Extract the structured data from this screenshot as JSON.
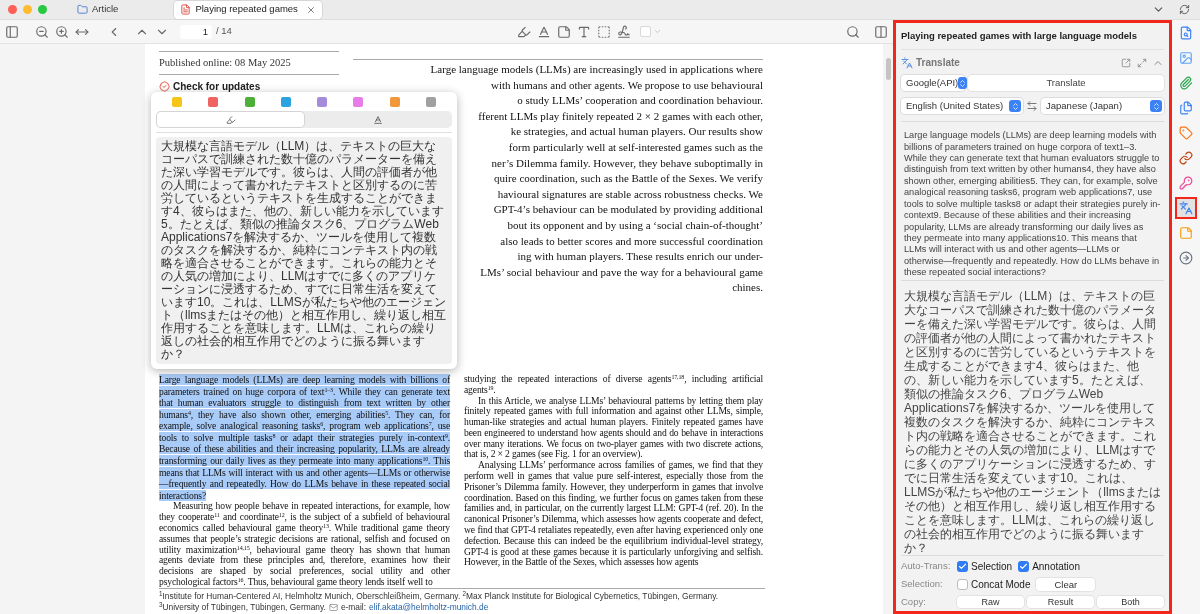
{
  "tabs": [
    {
      "label": "Article",
      "kind": "folder",
      "selected": false
    },
    {
      "label": "Playing repeated games",
      "kind": "pdf",
      "selected": true
    }
  ],
  "toolbar": {
    "page": "1",
    "page_count": "/ 14"
  },
  "document": {
    "published": "Published online: 08 May 2025",
    "check_updates": "Check for updates",
    "abstract_lines": [
      "Large language models (LLMs) are increasingly used in applications where",
      "with humans and other agents. We propose to use behavioural",
      "o study LLMs’ cooperation and coordination behaviour.",
      "fferent LLMs play finitely repeated 2 × 2 games with each other,",
      "ke strategies, and actual human players. Our results show",
      "form particularly well at self-interested games such as the",
      "ner’s Dilemma family. However, they behave suboptimally in",
      "quire coordination, such as the Battle of the Sexes. We verify",
      "havioural signatures are stable across robustness checks. We",
      "GPT-4’s behaviour can be modulated by providing additional",
      "bout its opponent and by using a ‘social chain-of-thought’",
      "also leads to better scores and more successful coordination",
      "ing with human players. These results enrich our under-",
      "LMs’ social behaviour and pave the way for a behavioural game",
      "chines."
    ],
    "left_column": [
      {
        "kind": "highlighted",
        "text": "Large language models (LLMs) are deep learning models with billions of parameters trained on huge corpora of text$^{1–3}$. While they can generate text that human evaluators struggle to distinguish from text written by other humans$^{4}$, they have also shown other, emerging abilities$^{5}$. They can, for example, solve analogical reasoning tasks$^{6}$, program web applications$^{7}$, use tools to solve multiple tasks$^{8}$ or adapt their strategies purely in-context$^{9}$. Because of these abilities and their increasing popularity, LLMs are already transforming our daily lives as they permeate into many applications$^{10}$. This means that LLMs will interact with us and other agents—LLMs or otherwise—frequently and repeatedly. How do LLMs behave in these repeated social interactions?"
      },
      {
        "kind": "plain",
        "text": "Measuring how people behave in repeated interactions, for example, how they cooperate$^{11}$ and coordinate$^{12}$, is the subject of a subfield of behavioural economics called behavioural game theory$^{13}$. While traditional game theory assumes that people’s strategic decisions are rational, selfish and focused on utility maximization$^{14,15}$, behavioural game theory has shown that human agents deviate from these principles and, therefore, examines how their decisions are shaped by social preferences, social utility and other psychological factors$^{16}$. Thus, behavioural game theory lends itself well to"
      }
    ],
    "right_column": [
      {
        "kind": "continued",
        "text": "studying the repeated interactions of diverse agents$^{17,18}$, including artificial agents$^{19}$."
      },
      {
        "kind": "plain",
        "text": "In this Article, we analyse LLMs’ behavioural patterns by letting them play finitely repeated games with full information and against other LLMs, simple, human-like strategies and actual human players. Finitely repeated games have been engineered to understand how agents should and do behave in interactions over many iterations. We focus on two-player games with two discrete actions, that is, 2 × 2 games (see Fig. 1 for an overview)."
      },
      {
        "kind": "plain",
        "text": "Analysing LLMs’ performance across families of games, we find that they perform well in games that value pure self-interest, especially those from the Prisoner’s Dilemma family. However, they underperform in games that involve coordination. Based on this finding, we further focus on games taken from these families and, in particular, on the currently largest LLM: GPT-4 (ref. 20). In the canonical Prisoner’s Dilemma, which assesses how agents cooperate and defect, we find that GPT-4 retaliates repeatedly, even after having experienced only one defection. Because this can indeed be the equilibrium individual-level strategy, GPT-4 is good at these games because it is particularly unforgiving and selfish. However, in the Battle of the Sexes, which assesses how agents"
      }
    ],
    "footnote_1": "$^{1}$Institute for Human-Centered AI, Helmholtz Munich, Oberschleißheim, Germany. $^{2}$Max Planck Institute for Biological Cybernetics, Tübingen, Germany.",
    "footnote_2": "$^{3}$University of Tübingen, Tübingen, Germany.",
    "email_label": "e-mail:",
    "email": "elif.akata@helmholtz-munich.de"
  },
  "popup": {
    "colors": [
      {
        "color": "#f5c518"
      },
      {
        "color": "#f06262"
      },
      {
        "color": "#4caf3a"
      },
      {
        "color": "#2aa3e0"
      },
      {
        "color": "#a78bdb"
      },
      {
        "color": "#e87ce8"
      },
      {
        "color": "#f0983a"
      },
      {
        "color": "#a0a0a0"
      }
    ],
    "modes": [
      {
        "kind": "highlight",
        "selected": true
      },
      {
        "kind": "underline",
        "selected": false
      }
    ],
    "translation": "大規模な言語モデル（LLM）は、テキストの巨大なコーパスで訓練された数十億のパラメーターを備えた深い学習モデルです。彼らは、人間の評価者が他の人間によって書かれたテキストと区別するのに苦労しているというテキストを生成することができます4、彼らはまた、他の、新しい能力を示しています5。たとえば、類似の推論タスク6、プログラムWeb Applications7を解決するか、ツールを使用して複数のタスクを解決するか、純粋にコンテキスト内の戦略を適合させることができます。これらの能力とその人気の増加により、LLMはすでに多くのアプリケーションに浸透するため、すでに日常生活を変えています10。これは、LLMSが私たちや他のエージェント（llmsまたはその他）と相互作用し、繰り返し相互作用することを意味します。LLMは、これらの繰り返しの社会的相互作用でどのように振る舞いますか？"
  },
  "panel": {
    "title": "Playing repeated games with large language models",
    "section": "Translate",
    "engine": "Google(API)",
    "translate_button": "Translate",
    "source_lang": "English (United States)",
    "target_lang": "Japanese (Japan)",
    "source_text": "Large language models (LLMs) are deep learning models with billions of parameters trained on huge corpora of text1–3. While they can generate text that human evaluators struggle to distinguish from text written by other humans4, they have also shown other, emerging abilities5. They can, for example, solve analogical reasoning tasks6, program web applications7, use tools to solve multiple tasks8 or adapt their strategies purely in-context9. Because of these abilities and their increasing popularity, LLMs are already transforming our daily lives as they permeate into many applications10. This means that LLMs will interact with us and other agents—LLMs or otherwise—frequently and repeatedly. How do LLMs behave in these repeated social interactions?",
    "result_text": "大規模な言語モデル（LLM）は、テキストの巨大なコーパスで訓練された数十億のパラメーターを備えた深い学習モデルです。彼らは、人間の評価者が他の人間によって書かれたテキストと区別するのに苦労しているというテキストを生成することができます4、彼らはまた、他の、新しい能力を示しています5。たとえば、類似の推論タスク6、プログラムWeb Applications7を解決するか、ツールを使用して複数のタスクを解決するか、純粋にコンテキスト内の戦略を適合させることができます。これらの能力とその人気の増加により、LLMはすでに多くのアプリケーションに浸透するため、すでに日常生活を変えています10。これは、LLMSが私たちや他のエージェント（llmsまたはその他）と相互作用し、繰り返し相互作用することを意味します。LLMは、これらの繰り返しの社会的相互作用でどのように振る舞いますか？",
    "auto_trans_label": "Auto-Trans:",
    "auto_trans": [
      {
        "label": "Selection",
        "checked": true
      },
      {
        "label": "Annotation",
        "checked": true
      }
    ],
    "selection_label": "Selection:",
    "concat": {
      "label": "Concat Mode",
      "checked": false
    },
    "clear_button": "Clear",
    "copy_label": "Copy:",
    "copy_buttons": [
      "Raw",
      "Result",
      "Both"
    ]
  },
  "sidebar_icons": [
    {
      "kind": "info",
      "selected": false
    },
    {
      "kind": "image",
      "selected": false
    },
    {
      "kind": "attachment",
      "selected": false
    },
    {
      "kind": "copy",
      "selected": false
    },
    {
      "kind": "tag",
      "selected": false
    },
    {
      "kind": "link",
      "selected": false
    },
    {
      "kind": "key",
      "selected": false
    },
    {
      "kind": "translate",
      "selected": true
    },
    {
      "kind": "note",
      "selected": false
    },
    {
      "kind": "export",
      "selected": false
    }
  ]
}
